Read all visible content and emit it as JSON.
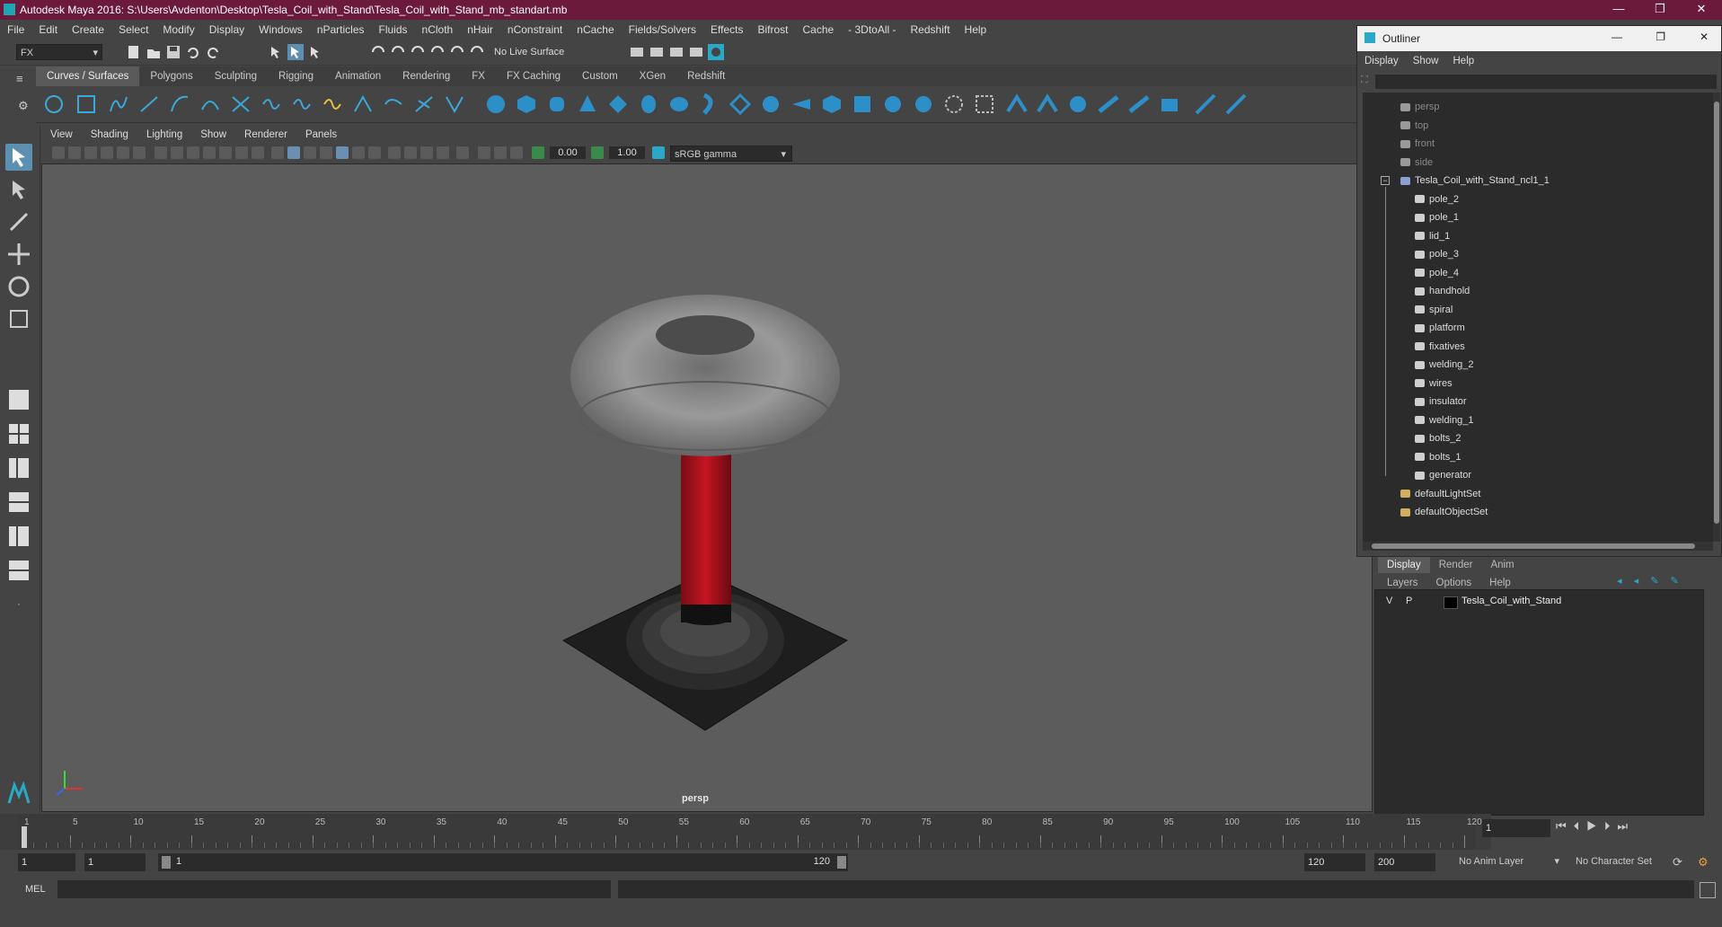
{
  "window": {
    "title": "Autodesk Maya 2016: S:\\Users\\Avdenton\\Desktop\\Tesla_Coil_with_Stand\\Tesla_Coil_with_Stand_mb_standart.mb",
    "minimize": "—",
    "maximize": "❐",
    "close": "✕"
  },
  "menus": [
    "File",
    "Edit",
    "Create",
    "Select",
    "Modify",
    "Display",
    "Windows",
    "nParticles",
    "Fluids",
    "nCloth",
    "nHair",
    "nConstraint",
    "nCache",
    "Fields/Solvers",
    "Effects",
    "Bifrost",
    "Cache",
    "- 3DtoAll -",
    "Redshift",
    "Help"
  ],
  "status": {
    "menuset": "FX",
    "live_surface": "No Live Surface"
  },
  "shelf": {
    "tabs": [
      "Curves / Surfaces",
      "Polygons",
      "Sculpting",
      "Rigging",
      "Animation",
      "Rendering",
      "FX",
      "FX Caching",
      "Custom",
      "XGen",
      "Redshift"
    ],
    "active": 0
  },
  "panel": {
    "menus": [
      "View",
      "Shading",
      "Lighting",
      "Show",
      "Renderer",
      "Panels"
    ],
    "exposure": "0.00",
    "gamma": "1.00",
    "colorspace": "sRGB gamma",
    "camera_label": "persp"
  },
  "outliner": {
    "title": "Outliner",
    "menus": [
      "Display",
      "Show",
      "Help"
    ],
    "cameras": [
      "persp",
      "top",
      "front",
      "side"
    ],
    "root": "Tesla_Coil_with_Stand_ncl1_1",
    "children": [
      "pole_2",
      "pole_1",
      "lid_1",
      "pole_3",
      "pole_4",
      "handhold",
      "spiral",
      "platform",
      "fixatives",
      "welding_2",
      "wires",
      "insulator",
      "welding_1",
      "bolts_2",
      "bolts_1",
      "generator"
    ],
    "sets": [
      "defaultLightSet",
      "defaultObjectSet"
    ]
  },
  "layers": {
    "tabs": [
      "Display",
      "Render",
      "Anim"
    ],
    "menus": [
      "Layers",
      "Options",
      "Help"
    ],
    "row": {
      "v": "V",
      "p": "P",
      "name": "Tesla_Coil_with_Stand"
    }
  },
  "timeline": {
    "ticks": [
      "1",
      "5",
      "10",
      "15",
      "20",
      "25",
      "30",
      "35",
      "40",
      "45",
      "50",
      "55",
      "60",
      "65",
      "70",
      "75",
      "80",
      "85",
      "90",
      "95",
      "100",
      "105",
      "110",
      "115",
      "120"
    ],
    "current_frame": "1"
  },
  "range": {
    "start": "1",
    "start2": "1",
    "slider_start": "1",
    "slider_end": "120",
    "end": "120",
    "max": "200",
    "anim_layer": "No Anim Layer",
    "char_set": "No Character Set"
  },
  "cmd": {
    "label": "MEL"
  },
  "colors": {
    "title": "#6b1a3c",
    "accent": "#2aa8c8",
    "coil_red": "#b0121c"
  }
}
